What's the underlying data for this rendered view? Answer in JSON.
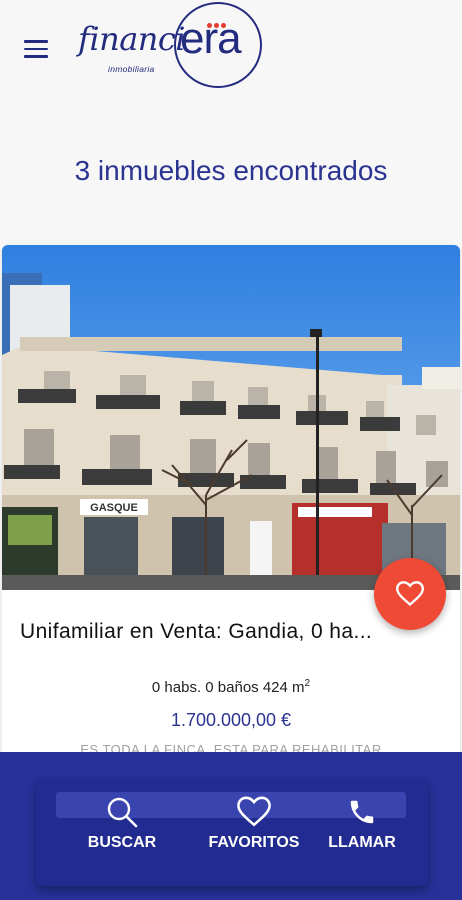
{
  "header": {
    "menu_icon": "hamburger-menu-icon",
    "logo": {
      "word": "financi",
      "mark": "era",
      "sub": "inmobiliaria"
    }
  },
  "results_title": "3 inmuebles encontrados",
  "listing": {
    "title": "Unifamiliar en Venta: Gandia, 0 ha...",
    "specs": "0 habs. 0 baños 424 m",
    "specs_sup": "2",
    "price": "1.700.000,00 €",
    "description": "ES TODA LA FINCA, ESTA PARA REHABILITAR",
    "sign": "GASQUE",
    "fav_icon": "heart-icon"
  },
  "bottom_nav": {
    "buscar": {
      "label": "BUSCAR",
      "icon": "search-icon"
    },
    "favoritos": {
      "label": "FAVORITOS",
      "icon": "heart-icon"
    },
    "llamar": {
      "label": "LLAMAR",
      "icon": "phone-icon"
    }
  },
  "colors": {
    "brand": "#232b7f",
    "accent": "#ef4a36",
    "bar": "#26319a"
  }
}
